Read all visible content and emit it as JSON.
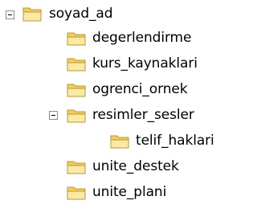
{
  "tree": {
    "root": {
      "label": "soyad_ad",
      "expanded": true,
      "icon": "folder-open-icon",
      "children": [
        {
          "label": "degerlendirme",
          "icon": "folder-icon"
        },
        {
          "label": "kurs_kaynaklari",
          "icon": "folder-icon"
        },
        {
          "label": "ogrenci_ornek",
          "icon": "folder-icon"
        },
        {
          "label": "resimler_sesler",
          "expanded": true,
          "icon": "folder-icon",
          "children": [
            {
              "label": "telif_haklari",
              "icon": "folder-icon"
            }
          ]
        },
        {
          "label": "unite_destek",
          "icon": "folder-icon"
        },
        {
          "label": "unite_plani",
          "icon": "folder-icon"
        }
      ]
    }
  },
  "colors": {
    "folder_body": "#f6d96f",
    "folder_front": "#fbe9a6",
    "folder_outline": "#b8963a"
  }
}
